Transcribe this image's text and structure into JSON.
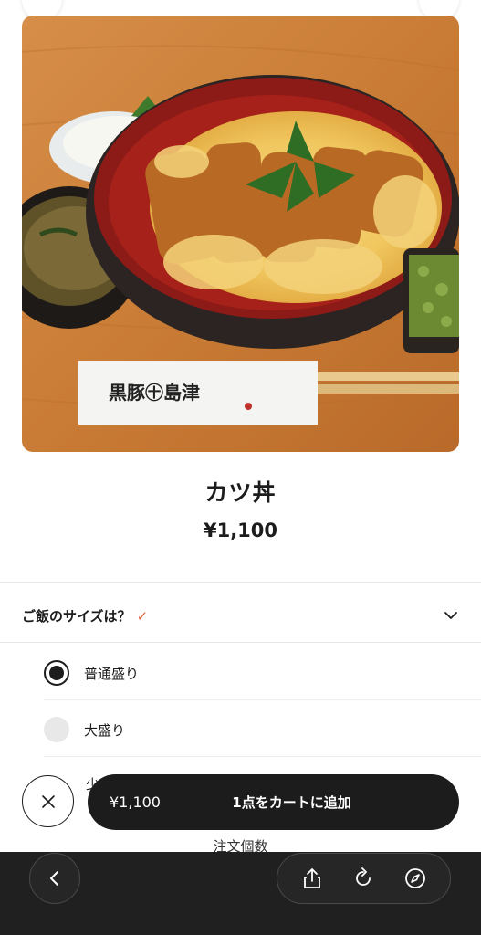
{
  "item": {
    "name": "カツ丼",
    "price": "¥1,100"
  },
  "photo": {
    "sign_text": "黒豚㊉島津"
  },
  "option_group": {
    "title": "ご飯のサイズは？",
    "check_icon": "checkmark-icon",
    "options": [
      {
        "label": "普通盛り",
        "selected": true
      },
      {
        "label": "大盛り",
        "selected": false
      },
      {
        "label": "少",
        "selected": false
      }
    ]
  },
  "cart_bar": {
    "price": "¥1,100",
    "label": "1点をカートに追加"
  },
  "quantity_label": "注文個数",
  "browser_toolbar": {
    "icons": [
      "chevron-left-icon",
      "share-icon",
      "reload-icon",
      "compass-icon"
    ]
  },
  "colors": {
    "accent": "#e0643c",
    "button_dark": "#1c1c1c",
    "toolbar_bg": "#202020"
  }
}
